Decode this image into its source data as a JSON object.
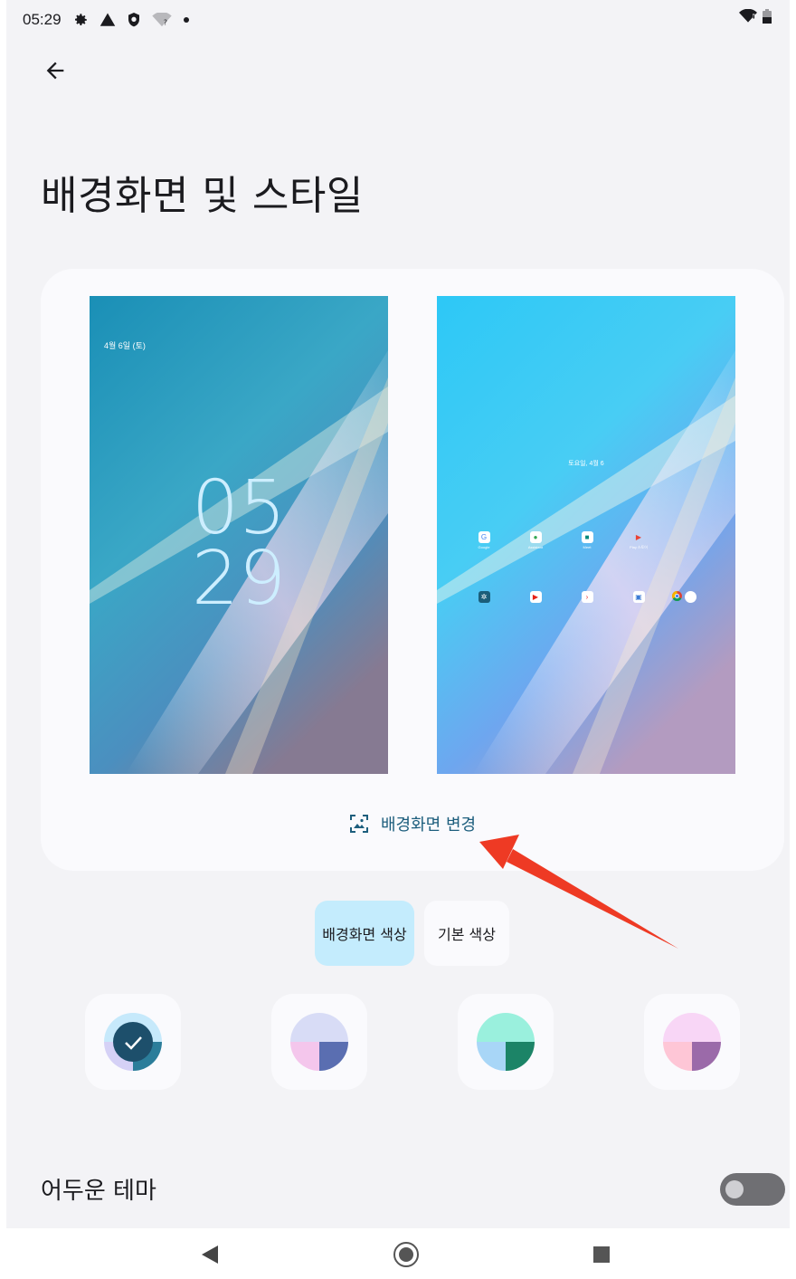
{
  "status_bar": {
    "time": "05:29"
  },
  "page": {
    "title": "배경화면 및 스타일"
  },
  "lock_preview": {
    "date": "4월 6일 (토)",
    "clock_hour": "05",
    "clock_minute": "29"
  },
  "home_preview": {
    "date": "토요일, 4월 6",
    "apps_row1": [
      {
        "label": "Google",
        "icon": "google-folder-icon"
      },
      {
        "label": "Assistant",
        "icon": "assistant-icon"
      },
      {
        "label": "Meet",
        "icon": "meet-icon"
      },
      {
        "label": "Play 스토어",
        "icon": "play-store-icon"
      }
    ],
    "apps_row2": [
      {
        "icon": "settings-icon"
      },
      {
        "icon": "youtube-icon"
      },
      {
        "icon": "play-icon"
      },
      {
        "icon": "gallery-icon"
      },
      {
        "icon": "chrome-icon"
      }
    ]
  },
  "actions": {
    "change_wallpaper": "배경화면 변경"
  },
  "color_tabs": {
    "wallpaper_colors": "배경화면 색상",
    "basic_colors": "기본 색상"
  },
  "swatches": [
    {
      "top": "#c6e9fb",
      "bottom_left": "#d5d1f6",
      "bottom_right": "#2b7d9a",
      "center": "#1d4f6b",
      "selected": true
    },
    {
      "top": "#d8dcf6",
      "bottom_left": "#f4c6ec",
      "bottom_right": "#5a6eb1",
      "selected": false
    },
    {
      "top": "#9af0dd",
      "bottom_left": "#a8d6f7",
      "bottom_right": "#1c8467",
      "selected": false
    },
    {
      "top": "#f8d6f6",
      "bottom_left": "#fec6d6",
      "bottom_right": "#9b6aa9",
      "selected": false
    }
  ],
  "settings": {
    "dark_theme": "어두운 테마",
    "dark_theme_on": false
  },
  "colors": {
    "accent": "#1d5e7d",
    "selected_tab": "#c4ecfd",
    "annotation_arrow": "#ee3a24"
  }
}
